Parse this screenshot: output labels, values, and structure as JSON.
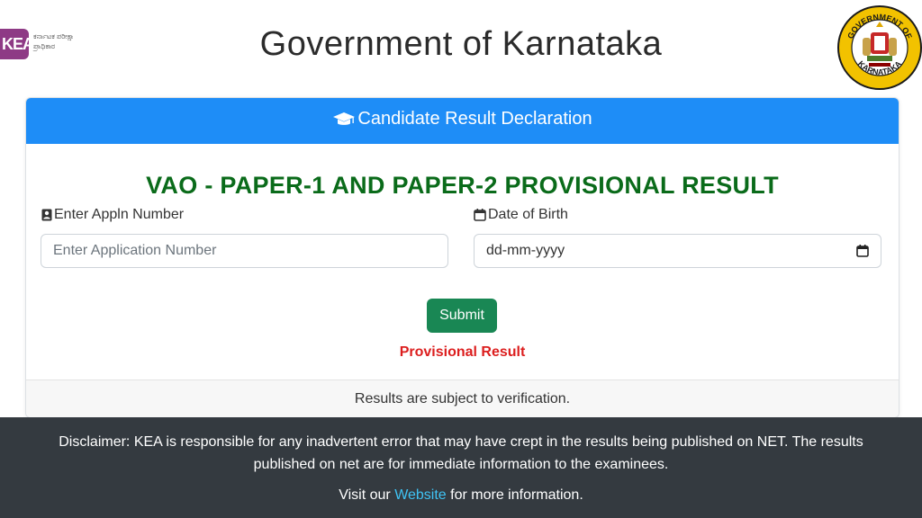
{
  "header": {
    "kea_mark": "KEA",
    "kea_text_line1": "ಕರ್ನಾಟಕ ಪರೀಕ್ಷಾ",
    "kea_text_line2": "ಪ್ರಾಧಿಕಾರ",
    "title": "Government of Karnataka",
    "emblem_text_top": "GOVERNMENT OF",
    "emblem_text_bottom": "KARNATAKA"
  },
  "card": {
    "header_label": "Candidate Result Declaration",
    "result_title": "VAO - PAPER-1 AND PAPER-2 PROVISIONAL RESULT",
    "appl_label": "Enter Appln Number",
    "appl_placeholder": "Enter Application Number",
    "dob_label": "Date of Birth",
    "dob_value": "dd-mm-yyyy",
    "submit_label": "Submit",
    "provisional_label": "Provisional Result",
    "footer_note": "Results are subject to verification."
  },
  "footer": {
    "disclaimer": "Disclaimer: KEA is responsible for any inadvertent error that may have crept in the results being published on NET. The results published on net are for immediate information to the examinees.",
    "visit_prefix": "Visit our",
    "visit_link": "Website",
    "visit_suffix": "for more information."
  },
  "colors": {
    "card_header": "#1e8df7",
    "result_title": "#0a6b1a",
    "submit": "#198754",
    "provisional": "#dc1e1e",
    "footer_bg": "#343a40",
    "link": "#3fc3f4"
  },
  "icons": {
    "card_header": "graduation-cap-icon",
    "appl": "id-card-icon",
    "dob": "calendar-icon"
  }
}
